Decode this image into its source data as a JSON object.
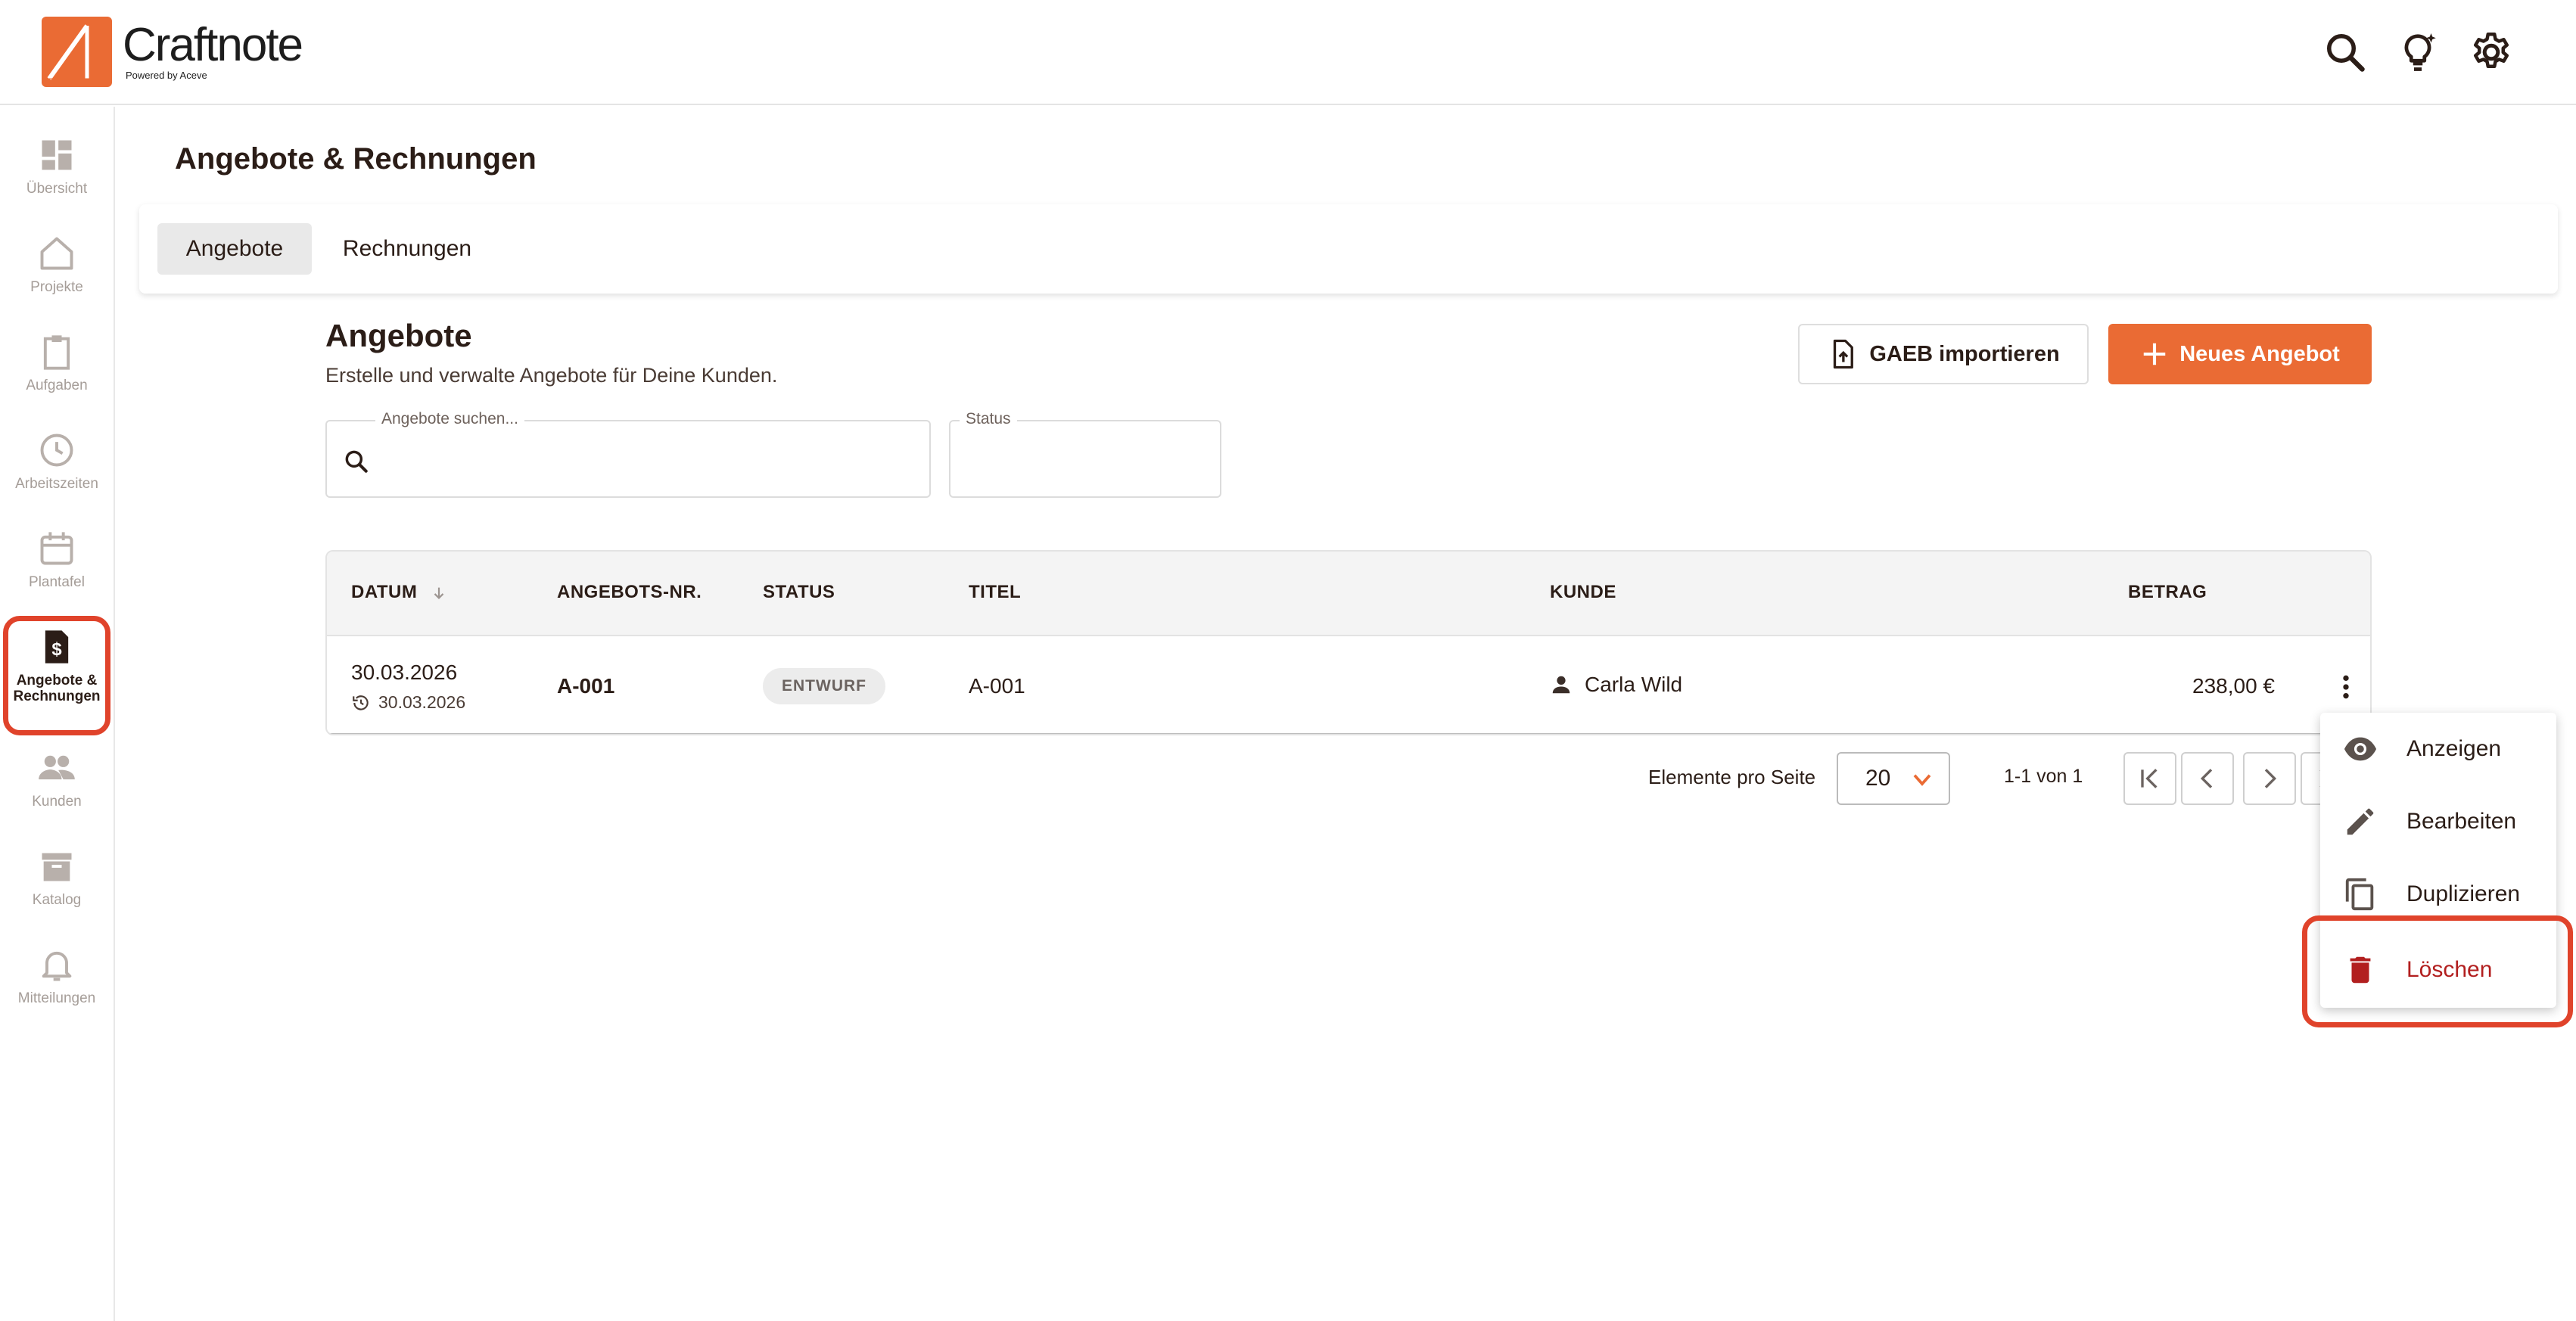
{
  "app": {
    "name": "Craftnote",
    "tagline": "Powered by Aceve",
    "brand_color": "#ea6b34",
    "highlight_color": "#e0432b"
  },
  "header_icons": [
    "search-icon",
    "lightbulb-sparkle-icon",
    "gear-icon"
  ],
  "sidebar": {
    "items": [
      {
        "label": "Übersicht",
        "icon": "dashboard-icon"
      },
      {
        "label": "Projekte",
        "icon": "home-icon"
      },
      {
        "label": "Aufgaben",
        "icon": "clipboard-icon"
      },
      {
        "label": "Arbeitszeiten",
        "icon": "clock-icon"
      },
      {
        "label": "Plantafel",
        "icon": "calendar-icon"
      },
      {
        "label": "Angebote & Rechnungen",
        "icon": "invoice-icon",
        "active": true
      },
      {
        "label": "Kunden",
        "icon": "people-icon"
      },
      {
        "label": "Katalog",
        "icon": "archive-icon"
      },
      {
        "label": "Mitteilungen",
        "icon": "bell-icon"
      }
    ]
  },
  "page": {
    "title": "Angebote & Rechnungen",
    "tabs": [
      {
        "label": "Angebote",
        "active": true
      },
      {
        "label": "Rechnungen",
        "active": false
      }
    ]
  },
  "section": {
    "title": "Angebote",
    "subtitle": "Erstelle und verwalte Angebote für Deine Kunden.",
    "import_button": "GAEB importieren",
    "new_button": "Neues Angebot"
  },
  "filters": {
    "search_label": "Angebote suchen...",
    "search_value": "",
    "status_label": "Status",
    "status_value": ""
  },
  "table": {
    "columns": [
      "DATUM",
      "ANGEBOTS-NR.",
      "STATUS",
      "TITEL",
      "KUNDE",
      "BETRAG"
    ],
    "rows": [
      {
        "date": "30.03.2026",
        "updated": "30.03.2026",
        "nr": "A-001",
        "status": "ENTWURF",
        "title": "A-001",
        "customer": "Carla Wild",
        "amount": "238,00 €"
      }
    ]
  },
  "pagination": {
    "per_page_label": "Elemente pro Seite",
    "per_page_value": "20",
    "range": "1-1 von 1"
  },
  "context_menu": {
    "items": [
      {
        "label": "Anzeigen",
        "icon": "eye-icon"
      },
      {
        "label": "Bearbeiten",
        "icon": "pencil-icon"
      },
      {
        "label": "Duplizieren",
        "icon": "copy-icon"
      },
      {
        "label": "Löschen",
        "icon": "trash-icon",
        "danger": true
      }
    ]
  }
}
